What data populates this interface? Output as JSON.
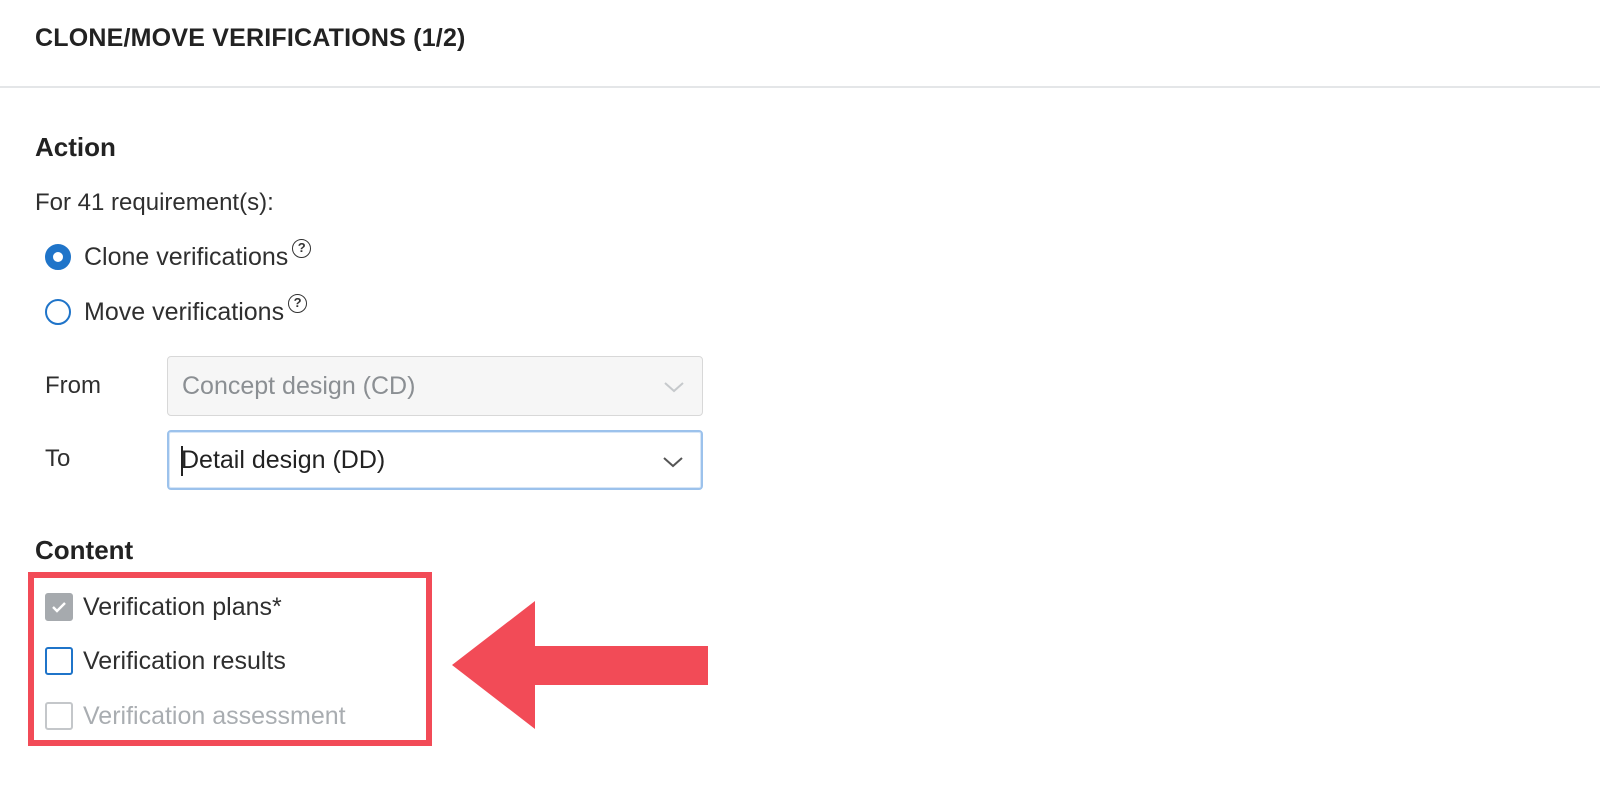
{
  "header": {
    "title": "CLONE/MOVE VERIFICATIONS (1/2)"
  },
  "action": {
    "title": "Action",
    "subtitle": "For 41 requirement(s):",
    "options": [
      {
        "label": "Clone verifications",
        "checked": true,
        "help_icon": "question-circle-icon"
      },
      {
        "label": "Move verifications",
        "checked": false,
        "help_icon": "question-circle-icon"
      }
    ],
    "from": {
      "label": "From",
      "value": "Concept design (CD)",
      "disabled": true
    },
    "to": {
      "label": "To",
      "value": "Detail design (DD)",
      "disabled": false
    }
  },
  "content": {
    "title": "Content",
    "items": [
      {
        "label": "Verification plans*",
        "checked": true,
        "disabled": true
      },
      {
        "label": "Verification results",
        "checked": false,
        "disabled": false
      },
      {
        "label": "Verification assessment",
        "checked": false,
        "disabled": true
      }
    ]
  },
  "colors": {
    "accent": "#1f74c9",
    "annotation": "#f24b57",
    "disabled_text": "#a9adb1"
  }
}
